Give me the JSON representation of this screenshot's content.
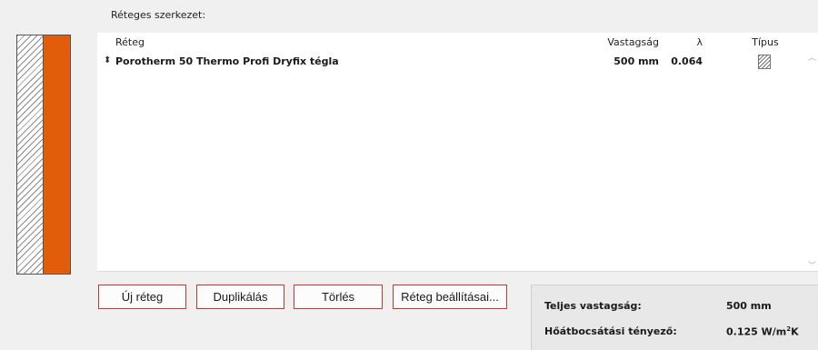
{
  "section_label": "Réteges szerkezet:",
  "colors": {
    "layer": "#e25d0a",
    "button_border": "#c0392b"
  },
  "table": {
    "columns": {
      "name": "Réteg",
      "thickness": "Vastagság",
      "lambda": "λ",
      "type": "Típus"
    },
    "rows": [
      {
        "name": "Porotherm 50 Thermo Profi Dryfix tégla",
        "thickness": "500 mm",
        "lambda": "0.064",
        "type_icon": "hatch-icon"
      }
    ]
  },
  "buttons": {
    "new_layer": "Új réteg",
    "duplicate": "Duplikálás",
    "delete": "Törlés",
    "layer_settings": "Réteg beállításai..."
  },
  "summary": {
    "total_thickness_label": "Teljes vastagság:",
    "total_thickness_value": "500 mm",
    "u_label": "Hőátbocsátási tényező:",
    "u_value": "0.125",
    "u_unit_prefix": "W/m",
    "u_unit_exp": "2",
    "u_unit_suffix": "K"
  }
}
